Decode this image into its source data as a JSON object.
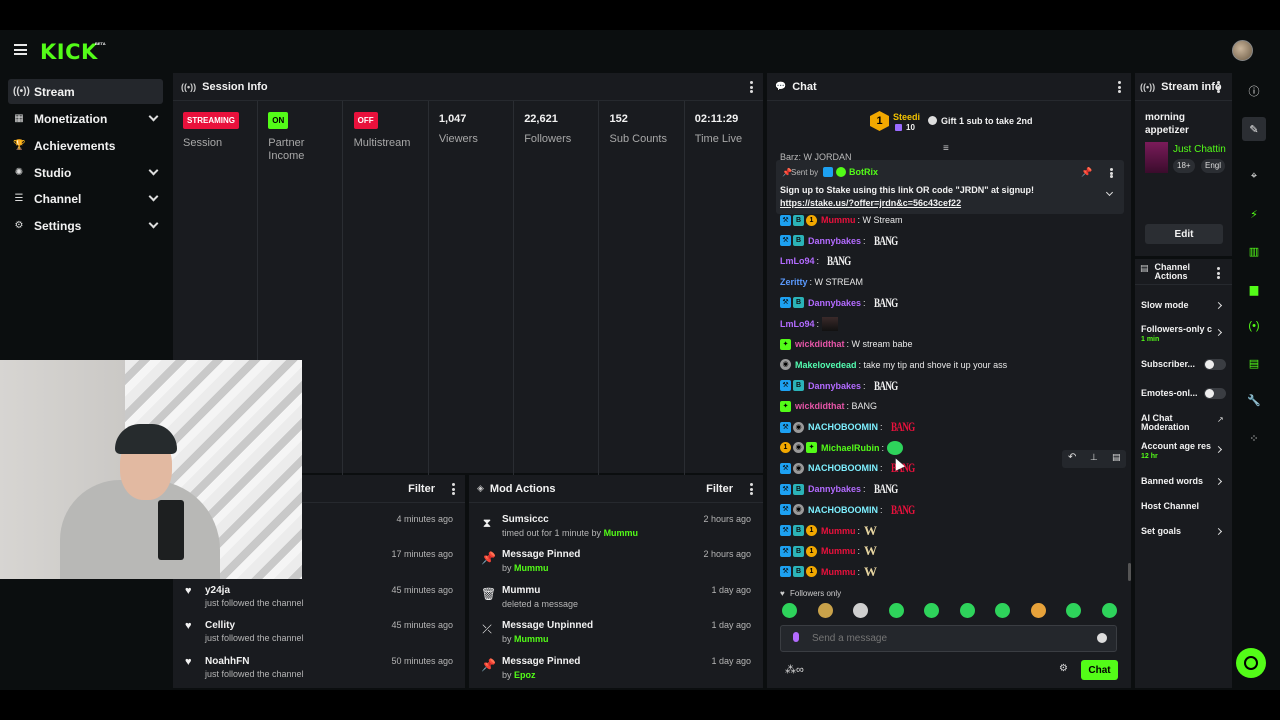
{
  "app": {
    "logo": "KICK",
    "beta": "BETA"
  },
  "sidebar": {
    "items": [
      {
        "label": "Stream",
        "icon": "broadcast-icon",
        "glyph": "((•))"
      },
      {
        "label": "Monetization",
        "icon": "dollar-icon",
        "glyph": "▦"
      },
      {
        "label": "Achievements",
        "icon": "trophy-icon",
        "glyph": "🏆"
      },
      {
        "label": "Studio",
        "icon": "studio-icon",
        "glyph": "✺"
      },
      {
        "label": "Channel",
        "icon": "channel-icon",
        "glyph": "☰"
      },
      {
        "label": "Settings",
        "icon": "gear-icon",
        "glyph": "⚙"
      }
    ]
  },
  "session": {
    "title": "Session Info",
    "stats": [
      {
        "value": "STREAMING",
        "label": "Session"
      },
      {
        "value": "ON",
        "label": "Partner Income"
      },
      {
        "value": "OFF",
        "label": "Multistream"
      },
      {
        "value": "1,047",
        "label": "Viewers"
      },
      {
        "value": "22,621",
        "label": "Followers"
      },
      {
        "value": "152",
        "label": "Sub Counts"
      },
      {
        "value": "02:11:29",
        "label": "Time Live"
      }
    ]
  },
  "activity": {
    "filter": "Filter",
    "items": [
      {
        "name": "",
        "sub": "",
        "time": "4 minutes ago"
      },
      {
        "name": "",
        "sub": "",
        "time": "17 minutes ago"
      },
      {
        "name": "y24ja",
        "sub": "just followed the channel",
        "time": "45 minutes ago"
      },
      {
        "name": "Cellity",
        "sub": "just followed the channel",
        "time": "45 minutes ago"
      },
      {
        "name": "NoahhFN",
        "sub": "just followed the channel",
        "time": "50 minutes ago"
      }
    ]
  },
  "mod": {
    "title": "Mod Actions",
    "filter": "Filter",
    "items": [
      {
        "icon": "hourglass-icon",
        "glyph": "⧗",
        "title": "Sumsiccc",
        "sub": "timed out for 1 minute by ",
        "by": "Mummu",
        "time": "2 hours ago"
      },
      {
        "icon": "pin-icon",
        "glyph": "📌",
        "title": "Message Pinned",
        "sub": "by ",
        "by": "Mummu",
        "time": "2 hours ago"
      },
      {
        "icon": "trash-icon",
        "glyph": "🗑",
        "title": "Mummu",
        "sub": "deleted a message",
        "by": "",
        "time": "1 day ago"
      },
      {
        "icon": "unpin-icon",
        "glyph": "⤫",
        "title": "Message Unpinned",
        "sub": "by ",
        "by": "Mummu",
        "time": "1 day ago"
      },
      {
        "icon": "pin-icon",
        "glyph": "📌",
        "title": "Message Pinned",
        "sub": "by ",
        "by": "Epoz",
        "time": "1 day ago"
      }
    ]
  },
  "chat": {
    "title": "Chat",
    "leader": {
      "rank": "1",
      "name": "Steedi",
      "count": "10"
    },
    "gift": "Gift 1 sub to take 2nd",
    "partial_line": "Barz: W JORDAN",
    "pinned": {
      "sent_by": "Sent by",
      "bot": "BotRix",
      "text": "Sign up to Stake using this link OR code \"JRDN\" at signup!",
      "link": "https://stake.us/?offer=jrdn&c=56c43cef22"
    },
    "messages": [
      {
        "badges": [
          "blue",
          "teal",
          "gold"
        ],
        "user": "Mummu",
        "color": "#e9113c",
        "text": ": W Stream",
        "emote": ""
      },
      {
        "badges": [
          "blue",
          "teal"
        ],
        "user": "Dannybakes",
        "color": "#b36bff",
        "text": ":",
        "emote": "BANG"
      },
      {
        "badges": [],
        "user": "LmLo94",
        "color": "#b36bff",
        "text": ":",
        "emote": "BANG"
      },
      {
        "badges": [],
        "user": "Zeritty",
        "color": "#5b9bff",
        "text": ": W STREAM",
        "emote": ""
      },
      {
        "badges": [
          "blue",
          "teal"
        ],
        "user": "Dannybakes",
        "color": "#b36bff",
        "text": ":",
        "emote": "BANG"
      },
      {
        "badges": [],
        "user": "LmLo94",
        "color": "#b36bff",
        "text": ":",
        "emote": "IMG"
      },
      {
        "badges": [
          "grn"
        ],
        "user": "wickdidthat",
        "color": "#e655a8",
        "text": ": W stream babe",
        "emote": ""
      },
      {
        "badges": [
          "grey"
        ],
        "user": "Makelovedead",
        "color": "#53fcb0",
        "text": ": take my tip and shove it up your ass",
        "emote": ""
      },
      {
        "badges": [
          "blue",
          "teal"
        ],
        "user": "Dannybakes",
        "color": "#b36bff",
        "text": ":",
        "emote": "BANG"
      },
      {
        "badges": [
          "grn"
        ],
        "user": "wickdidthat",
        "color": "#e655a8",
        "text": ": BANG",
        "emote": ""
      },
      {
        "badges": [
          "blue",
          "grey"
        ],
        "user": "NACHOBOOMIN",
        "color": "#7ef0ff",
        "text": ":",
        "emote": "REDBANG"
      },
      {
        "badges": [
          "gold",
          "grey",
          "grn"
        ],
        "user": "MichaelRubin",
        "color": "#53fc18",
        "text": ":",
        "emote": "GREEN"
      },
      {
        "badges": [
          "blue",
          "grey"
        ],
        "user": "NACHOBOOMIN",
        "color": "#7ef0ff",
        "text": ":",
        "emote": "REDBANG"
      },
      {
        "badges": [
          "blue",
          "teal"
        ],
        "user": "Dannybakes",
        "color": "#b36bff",
        "text": ":",
        "emote": "BANG"
      },
      {
        "badges": [
          "blue",
          "grey"
        ],
        "user": "NACHOBOOMIN",
        "color": "#7ef0ff",
        "text": ":",
        "emote": "REDBANG"
      },
      {
        "badges": [
          "blue",
          "teal",
          "gold"
        ],
        "user": "Mummu",
        "color": "#e9113c",
        "text": ":",
        "emote": "W"
      },
      {
        "badges": [
          "blue",
          "teal",
          "gold"
        ],
        "user": "Mummu",
        "color": "#e9113c",
        "text": ":",
        "emote": "W"
      },
      {
        "badges": [
          "blue",
          "teal",
          "gold"
        ],
        "user": "Mummu",
        "color": "#e9113c",
        "text": ":",
        "emote": "W"
      }
    ],
    "followers_only": "Followers only",
    "placeholder": "Send a message",
    "send_label": "Chat",
    "bang": "BANG",
    "w": "W"
  },
  "streaminfo": {
    "title": "Stream info",
    "stream_title": "morning appetizer",
    "category": "Just Chattin",
    "tags": [
      "18+",
      "Engl"
    ],
    "edit": "Edit"
  },
  "channel_actions": {
    "title": "Channel Actions",
    "items": [
      {
        "label": "Slow mode",
        "type": "chevron",
        "sub": ""
      },
      {
        "label": "Followers-only c",
        "type": "chevron",
        "sub": "1 min"
      },
      {
        "label": "Subscriber...",
        "type": "toggle",
        "sub": ""
      },
      {
        "label": "Emotes-onl...",
        "type": "toggle",
        "sub": ""
      },
      {
        "label": "AI Chat Moderation",
        "type": "external",
        "sub": ""
      },
      {
        "label": "Account age res",
        "type": "chevron",
        "sub": "12 hr"
      },
      {
        "label": "Banned words",
        "type": "chevron",
        "sub": ""
      },
      {
        "label": "Host Channel",
        "type": "none",
        "sub": ""
      },
      {
        "label": "Set goals",
        "type": "chevron",
        "sub": ""
      }
    ]
  },
  "colors": {
    "accent": "#53fc18",
    "panel": "#191b1f",
    "bg": "#0b0e0f",
    "live": "#e9113c"
  }
}
